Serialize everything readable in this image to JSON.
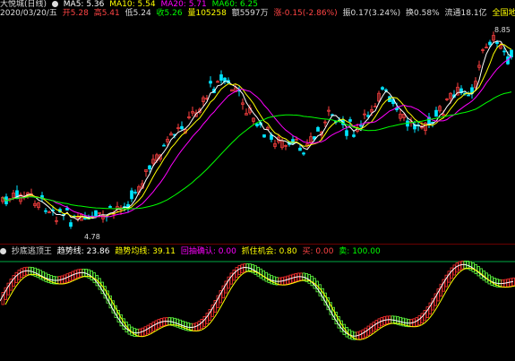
{
  "header": {
    "title": "大悦城(日线)",
    "ma5": "MA5: 5.36",
    "ma10": "MA10: 5.54",
    "ma20": "MA20: 5.71",
    "ma60": "MA60: 6.25",
    "date": "2020/03/20/五",
    "open": "开5.28",
    "high": "高5.41",
    "low": "低5.24",
    "close": "收5.26",
    "volume": "量105258",
    "amount": "额5597万",
    "change": "涨-0.15(-2.86%)",
    "amplitude": "振0.17(3.24%)",
    "turnover": "换0.58%",
    "float": "流通18.1亿",
    "sector": "全国地产"
  },
  "price_labels": {
    "high": "8.85",
    "low": "4.78"
  },
  "indicator": {
    "name": "抄底逃顶王",
    "trend_line": "趋势线: 23.86",
    "trend_avg": "趋势均线: 39.11",
    "rebound": "回抽确认: 0.00",
    "chance": "抓住机会: 0.80",
    "buy": "买: 0.00",
    "sell": "卖: 100.00"
  },
  "colors": {
    "up": "#ff4040",
    "down": "#00e5ff",
    "ma5": "#ffffff",
    "ma10": "#ffff00",
    "ma20": "#ff00ff",
    "ma60": "#00ff00",
    "accent": "#ffff00"
  }
}
